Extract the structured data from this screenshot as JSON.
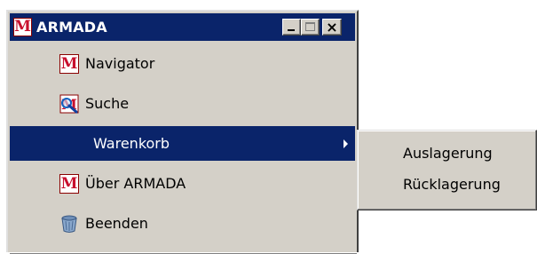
{
  "window": {
    "title": "ARMADA",
    "app_icon_letter": "M",
    "controls": {
      "minimize": "_",
      "maximize": "□",
      "close": "×"
    }
  },
  "menu": {
    "items": [
      {
        "label": "Navigator",
        "icon": "m-logo-icon"
      },
      {
        "label": "Suche",
        "icon": "search-icon"
      },
      {
        "label": "Warenkorb",
        "icon": "none",
        "selected": true,
        "has_submenu": true
      },
      {
        "label": "Über ARMADA",
        "icon": "m-logo-icon"
      },
      {
        "label": "Beenden",
        "icon": "trash-bin-icon"
      }
    ],
    "icon_letter": "M"
  },
  "submenu": {
    "items": [
      {
        "label": "Auslagerung"
      },
      {
        "label": "Rücklagerung"
      }
    ]
  },
  "colors": {
    "titlebar": "#0a246a",
    "selection": "#0a246a",
    "face": "#d4d0c8",
    "brand_red": "#c8102e"
  }
}
